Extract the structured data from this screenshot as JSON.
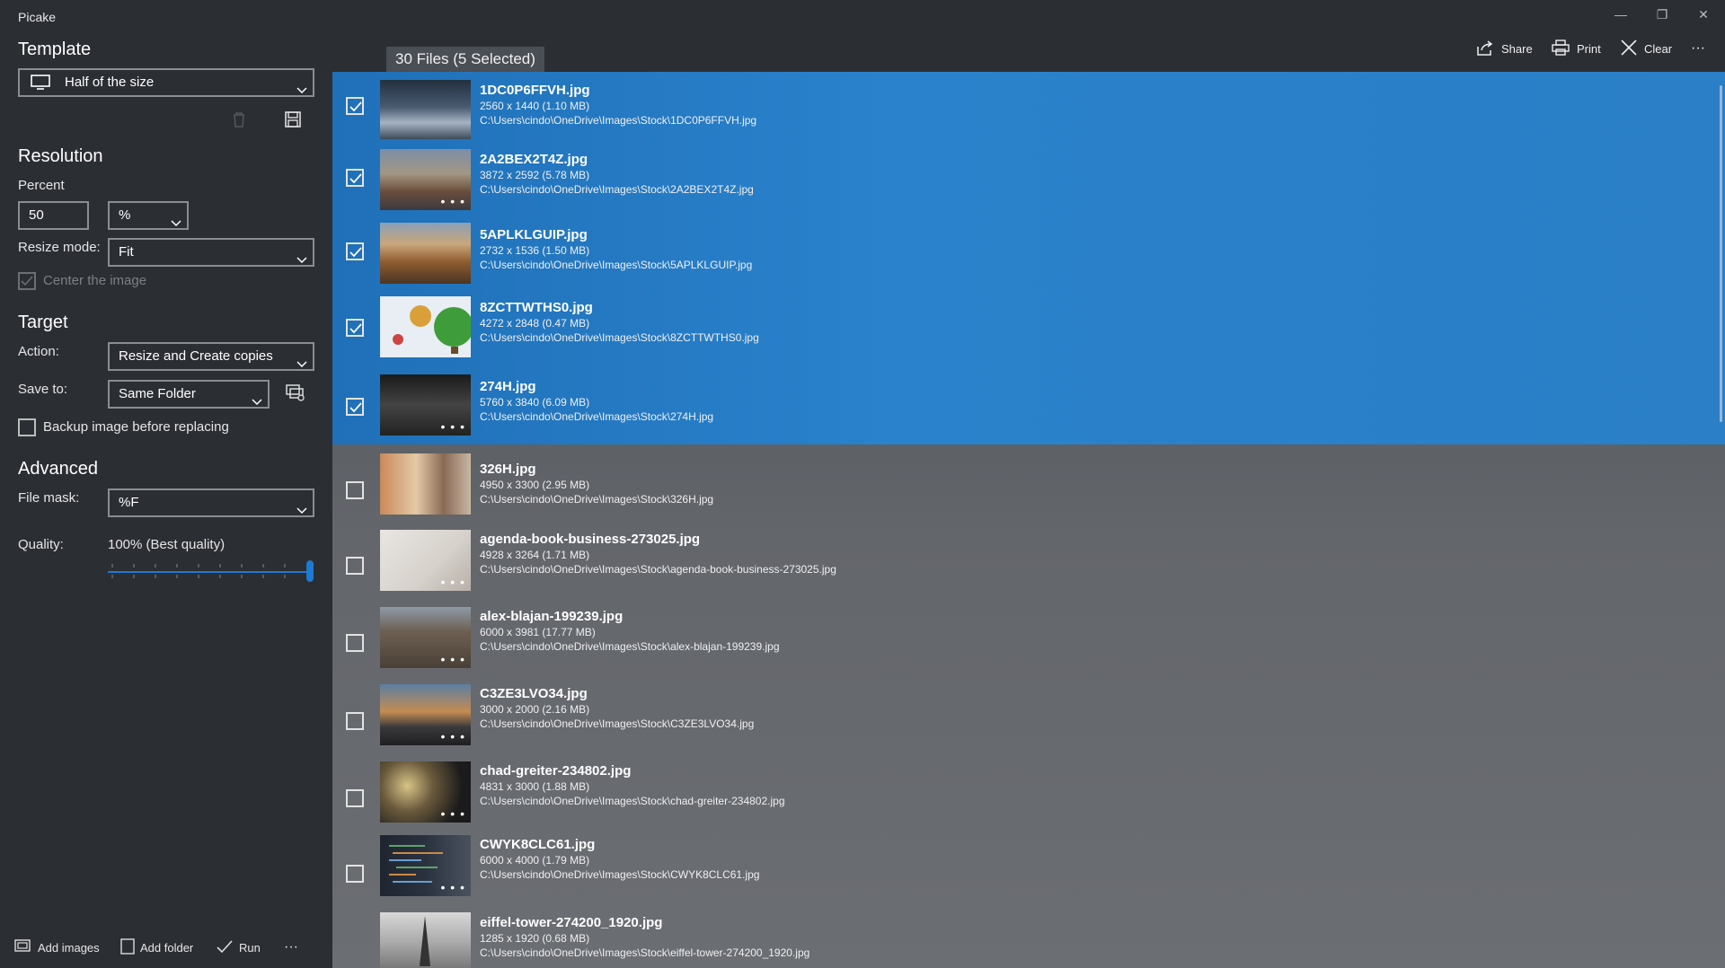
{
  "app_title": "Picake",
  "window_controls": {
    "minimize": "—",
    "restore": "❐",
    "close": "✕"
  },
  "sidebar": {
    "template_heading": "Template",
    "template_value": "Half of the size",
    "resolution_heading": "Resolution",
    "percent_label": "Percent",
    "percent_value": "50",
    "unit_value": "%",
    "resize_mode_label": "Resize mode:",
    "resize_mode_value": "Fit",
    "center_image_label": "Center the image",
    "target_heading": "Target",
    "action_label": "Action:",
    "action_value": "Resize and Create copies",
    "save_to_label": "Save to:",
    "save_to_value": "Same Folder",
    "backup_label": "Backup image before replacing",
    "advanced_heading": "Advanced",
    "file_mask_label": "File mask:",
    "file_mask_value": "%F",
    "quality_label": "Quality:",
    "quality_value_text": "100% (Best quality)",
    "quality_level": 1.0
  },
  "bottom_bar": {
    "add_images": "Add images",
    "add_folder": "Add folder",
    "run": "Run",
    "more": "···"
  },
  "main": {
    "file_count": "30 Files (5 Selected)",
    "commands": {
      "share": "Share",
      "print": "Print",
      "clear": "Clear",
      "more": "···"
    },
    "accent": "#2a7fc6"
  },
  "files": [
    {
      "name": "1DC0P6FFVH.jpg",
      "meta": "2560 x 1440 (1.10 MB)",
      "path": "C:\\Users\\cindo\\OneDrive\\Images\\Stock\\1DC0P6FFVH.jpg",
      "selected": true
    },
    {
      "name": "2A2BEX2T4Z.jpg",
      "meta": "3872 x 2592 (5.78 MB)",
      "path": "C:\\Users\\cindo\\OneDrive\\Images\\Stock\\2A2BEX2T4Z.jpg",
      "selected": true
    },
    {
      "name": "5APLKLGUIP.jpg",
      "meta": "2732 x 1536 (1.50 MB)",
      "path": "C:\\Users\\cindo\\OneDrive\\Images\\Stock\\5APLKLGUIP.jpg",
      "selected": true
    },
    {
      "name": "8ZCTTWTHS0.jpg",
      "meta": "4272 x 2848 (0.47 MB)",
      "path": "C:\\Users\\cindo\\OneDrive\\Images\\Stock\\8ZCTTWTHS0.jpg",
      "selected": true
    },
    {
      "name": "274H.jpg",
      "meta": "5760 x 3840 (6.09 MB)",
      "path": "C:\\Users\\cindo\\OneDrive\\Images\\Stock\\274H.jpg",
      "selected": true
    },
    {
      "name": "326H.jpg",
      "meta": "4950 x 3300 (2.95 MB)",
      "path": "C:\\Users\\cindo\\OneDrive\\Images\\Stock\\326H.jpg",
      "selected": false
    },
    {
      "name": "agenda-book-business-273025.jpg",
      "meta": "4928 x 3264 (1.71 MB)",
      "path": "C:\\Users\\cindo\\OneDrive\\Images\\Stock\\agenda-book-business-273025.jpg",
      "selected": false
    },
    {
      "name": "alex-blajan-199239.jpg",
      "meta": "6000 x 3981 (17.77 MB)",
      "path": "C:\\Users\\cindo\\OneDrive\\Images\\Stock\\alex-blajan-199239.jpg",
      "selected": false
    },
    {
      "name": "C3ZE3LVO34.jpg",
      "meta": "3000 x 2000 (2.16 MB)",
      "path": "C:\\Users\\cindo\\OneDrive\\Images\\Stock\\C3ZE3LVO34.jpg",
      "selected": false
    },
    {
      "name": "chad-greiter-234802.jpg",
      "meta": "4831 x 3000 (1.88 MB)",
      "path": "C:\\Users\\cindo\\OneDrive\\Images\\Stock\\chad-greiter-234802.jpg",
      "selected": false
    },
    {
      "name": "CWYK8CLC61.jpg",
      "meta": "6000 x 4000 (1.79 MB)",
      "path": "C:\\Users\\cindo\\OneDrive\\Images\\Stock\\CWYK8CLC61.jpg",
      "selected": false
    },
    {
      "name": "eiffel-tower-274200_1920.jpg",
      "meta": "1285 x 1920 (0.68 MB)",
      "path": "C:\\Users\\cindo\\OneDrive\\Images\\Stock\\eiffel-tower-274200_1920.jpg",
      "selected": false
    }
  ],
  "thumb_dots": "• • •"
}
